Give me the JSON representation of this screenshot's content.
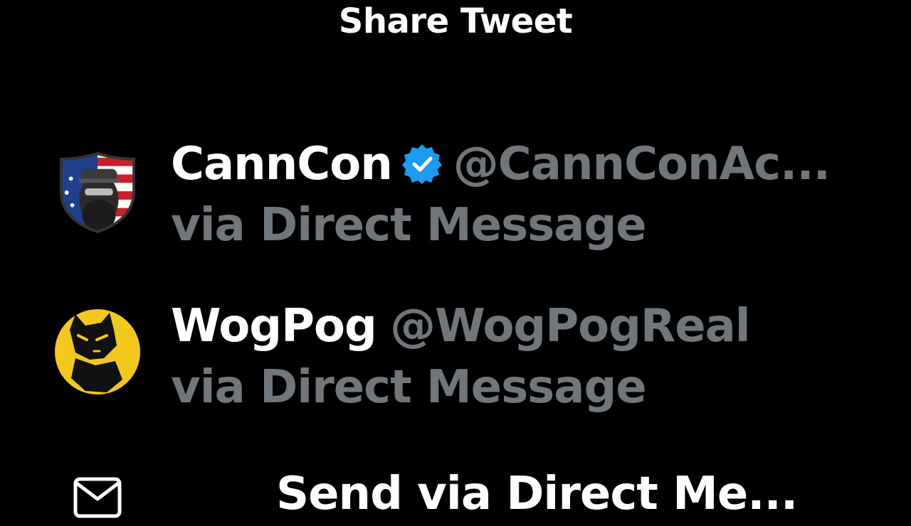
{
  "sheet": {
    "title": "Share Tweet"
  },
  "contacts": [
    {
      "display_name": "CannCon",
      "verified": true,
      "handle": "@CannConAc...",
      "channel": "via Direct Message",
      "avatar_icon": "bearded-man-flag-shield-avatar"
    },
    {
      "display_name": "WogPog",
      "verified": false,
      "handle": "@WogPogReal",
      "channel": "via Direct Message",
      "avatar_icon": "wogpog-yellow-cat-avatar"
    }
  ],
  "send_option": {
    "label": "Send via Direct Me...",
    "icon": "envelope-icon"
  },
  "colors": {
    "background": "#000000",
    "primary_text": "#ffffff",
    "secondary_text": "#71767b",
    "verified_badge": "#1d9bf0",
    "wogpog_yellow": "#f2c81e"
  }
}
